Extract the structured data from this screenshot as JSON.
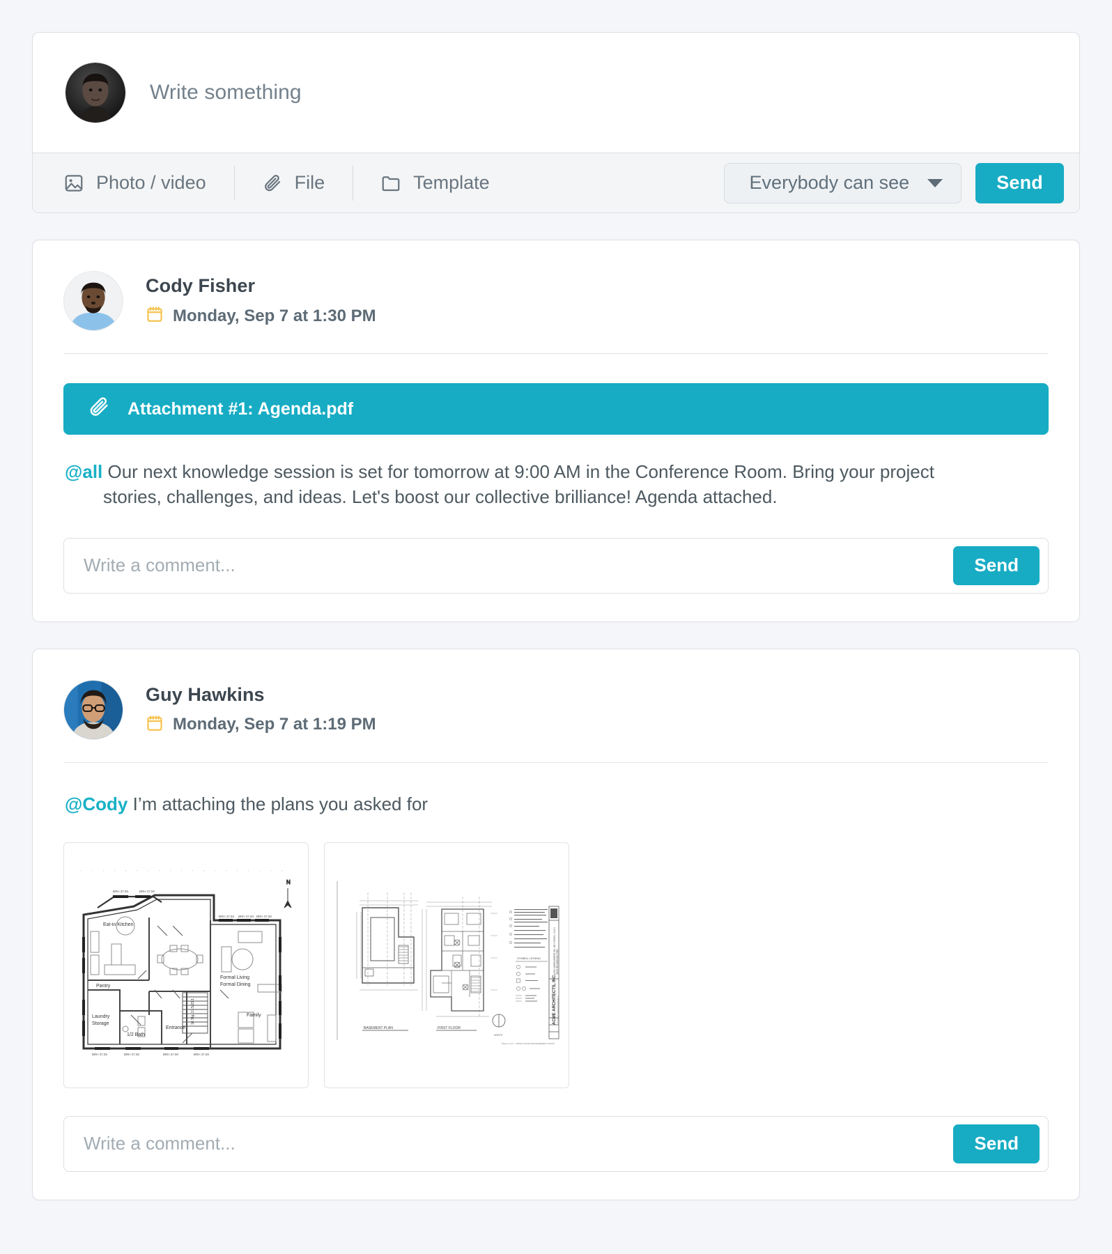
{
  "theme": {
    "accent": "#17acc4",
    "page_bg": "#f4f6f9",
    "card_bg": "#ffffff",
    "border": "#dcdfe3",
    "calendar_icon": "#f5c453",
    "text": "#4d5960"
  },
  "composer": {
    "placeholder": "Write something",
    "avatar_name": "current-user-avatar",
    "tools": [
      {
        "icon": "photo-icon",
        "label": "Photo / video"
      },
      {
        "icon": "paperclip-icon",
        "label": "File"
      },
      {
        "icon": "folder-icon",
        "label": "Template"
      }
    ],
    "visibility": {
      "selected": "Everybody can see",
      "options": [
        "Everybody can see"
      ]
    },
    "send_label": "Send"
  },
  "posts": [
    {
      "author": "Cody Fisher",
      "date_icon": "calendar-icon",
      "date": "Monday, Sep 7 at 1:30 PM",
      "attachment": {
        "icon": "paperclip-icon",
        "label": "Attachment #1: Agenda.pdf"
      },
      "mention": "@all",
      "text_line1": "Our next knowledge session is set for tomorrow at 9:00 AM in the Conference Room. Bring your project",
      "text_line2": "stories, challenges, and ideas. Let's boost our collective brilliance! Agenda attached.",
      "comment": {
        "placeholder": "Write a comment...",
        "value": "",
        "send_label": "Send"
      }
    },
    {
      "author": "Guy Hawkins",
      "date_icon": "calendar-icon",
      "date": "Monday, Sep 7 at 1:19 PM",
      "mention": "@Cody",
      "text_line1": "I’m attaching the plans you asked for",
      "thumbnails": [
        {
          "name": "floor-plan-thumbnail",
          "kind": "residential-floor-plan",
          "rooms": [
            "Eat-in Kitchen",
            "Pantry",
            "Laundry Storage",
            "1/2 Bath",
            "Entrance",
            "Formal Living Formal Dining",
            "Family"
          ],
          "stair_note": "16 Stg. 17.5/23.1",
          "compass": "N"
        },
        {
          "name": "architectural-drawing-thumbnail",
          "kind": "architectural-sheet",
          "sheet_labels": [
            "BASEMENT PLAN",
            "FIRST FLOOR"
          ],
          "title_block": "ACME ARCHITECTS, INC."
        }
      ],
      "comment": {
        "placeholder": "Write a comment...",
        "value": "",
        "send_label": "Send"
      }
    }
  ]
}
